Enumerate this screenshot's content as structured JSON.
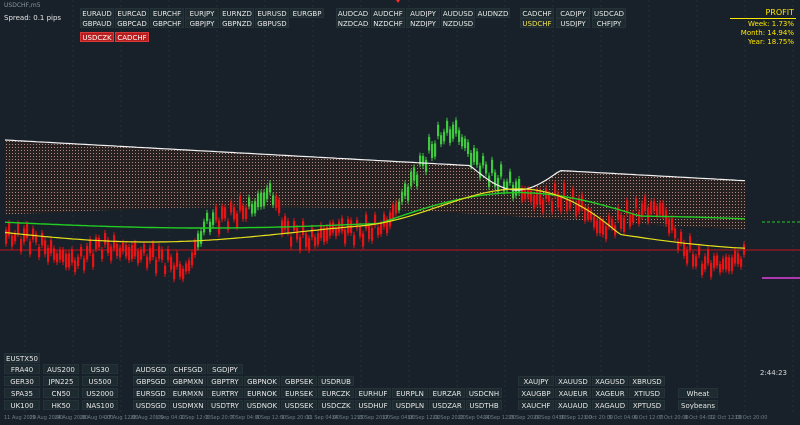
{
  "window": {
    "symbol_title": "USDCHF,m5",
    "spread": "Spread: 0.1 pips",
    "countdown": "2:44:23"
  },
  "profit": {
    "title": "PROFIT",
    "week": "Week:   1.73%",
    "month": "Month:  14.94%",
    "year": "Year:  18.75%"
  },
  "colors": {
    "background": "#182129",
    "bull": "#3ec93e",
    "bear": "#e61414",
    "ma_yellow": "#e8e01c",
    "ma_green": "#22cc22",
    "ma_white": "#f2f2f2",
    "baseline": "#c0141e",
    "accent": "#ffe800"
  },
  "buttons_top": [
    {
      "label": "EURAUD",
      "state": "normal"
    },
    {
      "label": "EURCAD",
      "state": "normal"
    },
    {
      "label": "EURCHF",
      "state": "normal"
    },
    {
      "label": "EURJPY",
      "state": "normal"
    },
    {
      "label": "EURNZD",
      "state": "normal"
    },
    {
      "label": "EURUSD",
      "state": "normal"
    },
    {
      "label": "EURGBP",
      "state": "normal"
    },
    {
      "label": "GBPAUD",
      "state": "normal"
    },
    {
      "label": "GBPCAD",
      "state": "normal"
    },
    {
      "label": "GBPCHF",
      "state": "normal"
    },
    {
      "label": "GBPJPY",
      "state": "normal"
    },
    {
      "label": "GBPNZD",
      "state": "normal"
    },
    {
      "label": "GBPUSD",
      "state": "normal"
    },
    {
      "label": "USDCZK",
      "state": "active"
    },
    {
      "label": "CADCHF",
      "state": "active"
    },
    {
      "label": "AUDCAD",
      "state": "normal"
    },
    {
      "label": "AUDCHF",
      "state": "normal"
    },
    {
      "label": "AUDJPY",
      "state": "normal"
    },
    {
      "label": "AUDUSD",
      "state": "normal"
    },
    {
      "label": "AUDNZD",
      "state": "normal"
    },
    {
      "label": "NZDCAD",
      "state": "normal"
    },
    {
      "label": "NZDCHF",
      "state": "normal"
    },
    {
      "label": "NZDJPY",
      "state": "normal"
    },
    {
      "label": "NZDUSD",
      "state": "normal"
    },
    {
      "label": "CADCHF",
      "state": "normal"
    },
    {
      "label": "CADJPY",
      "state": "normal"
    },
    {
      "label": "USDCAD",
      "state": "normal"
    },
    {
      "label": "USDCHF",
      "state": "highlight"
    },
    {
      "label": "USDJPY",
      "state": "normal"
    },
    {
      "label": "CHFJPY",
      "state": "normal"
    }
  ],
  "buttons_bottom": [
    {
      "label": "EUSTX50",
      "state": "normal"
    },
    {
      "label": "FRA40",
      "state": "normal"
    },
    {
      "label": "AUS200",
      "state": "normal"
    },
    {
      "label": "US30",
      "state": "normal"
    },
    {
      "label": "GER30",
      "state": "normal"
    },
    {
      "label": "JPN225",
      "state": "normal"
    },
    {
      "label": "US500",
      "state": "normal"
    },
    {
      "label": "SPA35",
      "state": "normal"
    },
    {
      "label": "CN50",
      "state": "normal"
    },
    {
      "label": "US2000",
      "state": "normal"
    },
    {
      "label": "UK100",
      "state": "normal"
    },
    {
      "label": "HK50",
      "state": "normal"
    },
    {
      "label": "NAS100",
      "state": "normal"
    },
    {
      "label": "AUDSGD",
      "state": "normal"
    },
    {
      "label": "CHFSGD",
      "state": "normal"
    },
    {
      "label": "SGDJPY",
      "state": "normal"
    },
    {
      "label": "GBPSGD",
      "state": "normal"
    },
    {
      "label": "GBPMXN",
      "state": "normal"
    },
    {
      "label": "GBPTRY",
      "state": "normal"
    },
    {
      "label": "GBPNOK",
      "state": "normal"
    },
    {
      "label": "GBPSEK",
      "state": "normal"
    },
    {
      "label": "USDRUB",
      "state": "normal"
    },
    {
      "label": "EURSGD",
      "state": "normal"
    },
    {
      "label": "EURMXN",
      "state": "normal"
    },
    {
      "label": "EURTRY",
      "state": "normal"
    },
    {
      "label": "EURNOK",
      "state": "normal"
    },
    {
      "label": "EURSEK",
      "state": "normal"
    },
    {
      "label": "EURCZK",
      "state": "normal"
    },
    {
      "label": "EURHUF",
      "state": "normal"
    },
    {
      "label": "EURPLN",
      "state": "normal"
    },
    {
      "label": "EURZAR",
      "state": "normal"
    },
    {
      "label": "USDCNH",
      "state": "normal"
    },
    {
      "label": "USDSGD",
      "state": "normal"
    },
    {
      "label": "USDMXN",
      "state": "normal"
    },
    {
      "label": "USDTRY",
      "state": "normal"
    },
    {
      "label": "USDNOK",
      "state": "normal"
    },
    {
      "label": "USDSEK",
      "state": "normal"
    },
    {
      "label": "USDCZK",
      "state": "normal"
    },
    {
      "label": "USDHUF",
      "state": "normal"
    },
    {
      "label": "USDPLN",
      "state": "normal"
    },
    {
      "label": "USDZAR",
      "state": "normal"
    },
    {
      "label": "USDTHB",
      "state": "normal"
    },
    {
      "label": "XAUJPY",
      "state": "normal"
    },
    {
      "label": "XAUUSD",
      "state": "normal"
    },
    {
      "label": "XAGUSD",
      "state": "normal"
    },
    {
      "label": "XBRUSD",
      "state": "normal"
    },
    {
      "label": "XAUGBP",
      "state": "normal"
    },
    {
      "label": "XAUEUR",
      "state": "normal"
    },
    {
      "label": "XAGEUR",
      "state": "normal"
    },
    {
      "label": "XTIUSD",
      "state": "normal"
    },
    {
      "label": "XAUCHF",
      "state": "normal"
    },
    {
      "label": "XAUAUD",
      "state": "normal"
    },
    {
      "label": "XAGAUD",
      "state": "normal"
    },
    {
      "label": "XPTUSD",
      "state": "normal"
    },
    {
      "label": "Wheat",
      "state": "normal"
    },
    {
      "label": "Soybeans",
      "state": "normal"
    }
  ],
  "time_axis": [
    "11 Aug 2020",
    "19 Aug 20:00",
    "24 Aug 20:00",
    "26 Aug 04:00",
    "27 Aug 12:00",
    "28 Aug 20:00",
    "1 Sep 04:00",
    "2 Sep 12:00",
    "3 Sep 20:00",
    "7 Sep 04:00",
    "8 Sep 12:00",
    "9 Sep 20:00",
    "11 Sep 04:00",
    "14 Sep 12:00",
    "15 Sep 20:00",
    "17 Sep 04:00",
    "18 Sep 12:00",
    "21 Sep 20:00",
    "23 Sep 04:00",
    "24 Sep 12:00",
    "25 Sep 20:00",
    "29 Sep 04:00",
    "30 Sep 12:00",
    "1 Oct 20:00",
    "5 Oct 04:00",
    "6 Oct 12:00",
    "7 Oct 20:00",
    "9 Oct 04:00",
    "12 Oct 12:00",
    "13 Oct 20:00"
  ]
}
